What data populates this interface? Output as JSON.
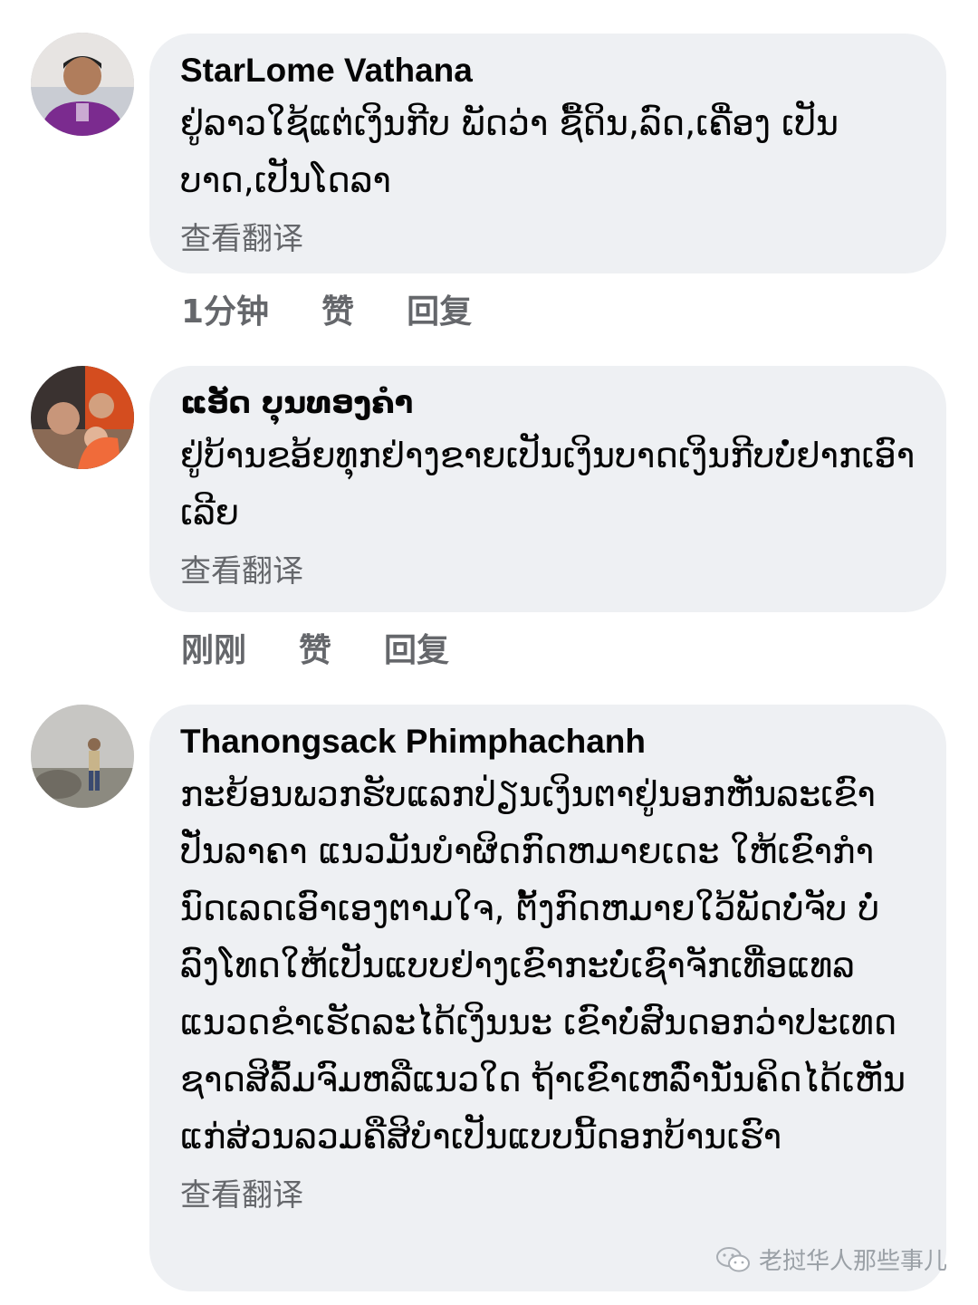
{
  "comments": [
    {
      "author": "StarLome Vathana",
      "text": "ຢູ່ລາວໃຊ້ແຕ່ເງິນກີບ ພັດວ່າ ຊື້ດິນ,ລົດ,ເຄື່ອງ ເປັນບາດ,ເປັນໂດລາ",
      "translate_label": "查看翻译",
      "time": "1分钟",
      "like_label": "赞",
      "reply_label": "回复"
    },
    {
      "author": "ແອັດ ບຸນທອງຄຳ",
      "text": "ຢູ່ບ້ານຂອ້ຍທຸກຢ່າງຂາຍເປັນເງິນບາດເງິນກີບບໍ່ຢາກເອົາເລີຍ",
      "translate_label": "查看翻译",
      "time": "刚刚",
      "like_label": "赞",
      "reply_label": "回复"
    },
    {
      "author": "Thanongsack Phimphachanh",
      "text": "ກະຍ້ອນພວກຮັບແລກປ່ຽນເງິນຕາຢູ່ນອກຫັ່ນລະເຂົາປັ່ນລາຄາ ແນວມັນບໍາຜິດກົດຫມາຍເດະ ໃຫ້ເຂົາກຳນົດເລດເອົາເອງຕາມໃຈ, ຕັ້ງກົດຫມາຍໃວ້ພັດບໍ່ຈັບ ບໍ່ລົງໂທດໃຫ້ເປັນແບບຢ່າງເຂົາກະບໍ່ເຊົາຈັກເທື່ອແທລແນວດຂຳເຮັດລະໄດ້ເງິນນະ ເຂົາບໍ່ສົນດອກວ່າປະເທດຊາດສິລົ້ມຈົມຫລືແນວໃດ ຖ້າເຂົາເຫລົ່ານັ່ນຄິດໄດ້ເຫັນແກ່ສ່ວນລວມຄືສິບໍາເປັນແບບນີ້ດອກບ້ານເຮົາ",
      "translate_label": "查看翻译"
    }
  ],
  "watermark": {
    "text": "老挝华人那些事儿",
    "icon": "wechat-icon"
  }
}
